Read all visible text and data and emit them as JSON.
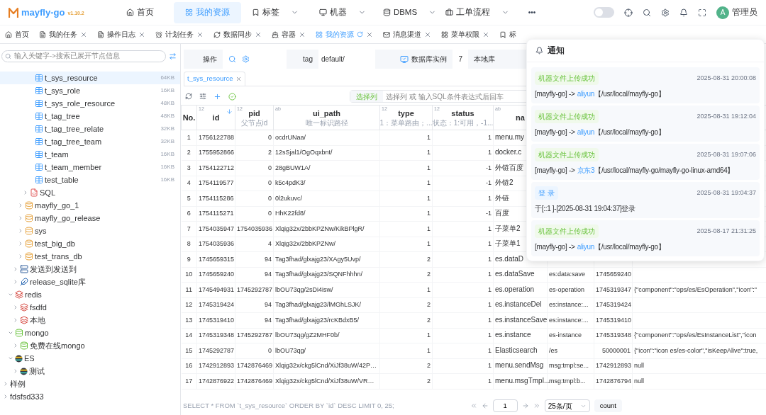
{
  "brand": {
    "name": "mayfly-go",
    "version": "v1.10.2"
  },
  "nav": [
    {
      "label": "首页",
      "selected": false,
      "dropdown": false
    },
    {
      "label": "我的资源",
      "selected": true,
      "dropdown": false
    },
    {
      "label": "标签",
      "selected": false,
      "dropdown": true
    },
    {
      "label": "机器",
      "selected": false,
      "dropdown": true
    },
    {
      "label": "DBMS",
      "selected": false,
      "dropdown": true
    },
    {
      "label": "工单流程",
      "selected": false,
      "dropdown": true
    }
  ],
  "more": "•••",
  "dark_mode": {
    "on": false
  },
  "user": {
    "initial": "A",
    "name": "管理员"
  },
  "tabs": [
    {
      "label": "首页",
      "selected": false,
      "closable": false
    },
    {
      "label": "我的任务",
      "selected": false,
      "closable": true
    },
    {
      "label": "操作日志",
      "selected": false,
      "closable": true
    },
    {
      "label": "计划任务",
      "selected": false,
      "closable": true
    },
    {
      "label": "数据同步",
      "selected": false,
      "closable": true
    },
    {
      "label": "容器",
      "selected": false,
      "closable": true
    },
    {
      "label": "我的资源",
      "selected": true,
      "closable": true
    },
    {
      "label": "消息渠道",
      "selected": false,
      "closable": true
    },
    {
      "label": "菜单权限",
      "selected": false,
      "closable": true
    },
    {
      "label": "标",
      "selected": false,
      "closable": false
    }
  ],
  "sidebar": {
    "search_placeholder": "输入关键字->搜索已展开节点信息",
    "tree": [
      {
        "children": [
          {
            "children": [
              {
                "children": [
                  {
                    "children": [
                      {
                        "children": [
                          {
                            "label": "t_sys_resource",
                            "kind": "table",
                            "size": "64KB",
                            "selected": true
                          },
                          {
                            "label": "t_sys_role",
                            "kind": "table",
                            "size": "16KB",
                            "selected": false
                          },
                          {
                            "label": "t_sys_role_resource",
                            "kind": "table",
                            "size": "48KB",
                            "selected": false
                          },
                          {
                            "label": "t_tag_tree",
                            "kind": "table",
                            "size": "48KB",
                            "selected": false
                          },
                          {
                            "label": "t_tag_tree_relate",
                            "kind": "table",
                            "size": "32KB",
                            "selected": false
                          },
                          {
                            "label": "t_tag_tree_team",
                            "kind": "table",
                            "size": "32KB",
                            "selected": false
                          },
                          {
                            "label": "t_team",
                            "kind": "table",
                            "size": "16KB",
                            "selected": false
                          },
                          {
                            "label": "t_team_member",
                            "kind": "table",
                            "size": "16KB",
                            "selected": false
                          },
                          {
                            "label": "test_table",
                            "kind": "table",
                            "size": "16KB",
                            "selected": false
                          }
                        ]
                      },
                      {
                        "label": "SQL",
                        "kind": "sql",
                        "expanded": false,
                        "selected": false
                      }
                    ]
                  },
                  {
                    "label": "mayfly_go_1",
                    "kind": "database",
                    "expanded": false,
                    "selected": false
                  },
                  {
                    "label": "mayfly_go_release",
                    "kind": "database",
                    "expanded": false,
                    "selected": false
                  },
                  {
                    "label": "sys",
                    "kind": "database",
                    "expanded": false,
                    "selected": false
                  },
                  {
                    "label": "test_big_db",
                    "kind": "database",
                    "expanded": false,
                    "selected": false
                  },
                  {
                    "label": "test_trans_db",
                    "kind": "database",
                    "expanded": false,
                    "selected": false
                  }
                ]
              },
              {
                "label": "发送到发送到",
                "kind": "server",
                "expanded": false,
                "selected": false
              },
              {
                "label": "release_sqlite库",
                "kind": "sqlite",
                "expanded": false,
                "selected": false
              }
            ]
          },
          {
            "label": "redis",
            "kind": "redis",
            "expanded": true,
            "selected": false,
            "children": [
              {
                "label": "fsdfd",
                "kind": "redis",
                "expanded": false,
                "selected": false
              },
              {
                "label": "本地",
                "kind": "redis",
                "expanded": false,
                "selected": false
              }
            ]
          },
          {
            "label": "mongo",
            "kind": "mongo",
            "expanded": true,
            "selected": false,
            "children": [
              {
                "label": "免费在线mongo",
                "kind": "mongo",
                "expanded": false,
                "selected": false
              }
            ]
          },
          {
            "label": "ES",
            "kind": "es",
            "expanded": true,
            "selected": false,
            "children": [
              {
                "label": "测试",
                "kind": "es",
                "expanded": false,
                "selected": false
              }
            ]
          }
        ]
      },
      {
        "label": "样例",
        "expanded": false,
        "selected": false
      },
      {
        "label": "fdsfsd333",
        "expanded": false,
        "selected": false
      }
    ]
  },
  "info_bar": {
    "action_label": "操作",
    "tag_label": "tag",
    "tag_value": "default/",
    "instance_label": "数据库实例",
    "instance_count": "7",
    "instance_name": "本地库"
  },
  "query_tabs": [
    {
      "label": "t_sys_resource",
      "selected": true
    }
  ],
  "toolbar": {
    "column_button": "选择列",
    "filter_placeholder": "选择列 或 输入SQL条件表达式后回车"
  },
  "table": {
    "columns": [
      {
        "label": "No."
      },
      {
        "label": "id",
        "type": "12",
        "sort_descending": true
      },
      {
        "label": "pid",
        "type": "12",
        "comment": "父节点id"
      },
      {
        "label": "ui_path",
        "type": "ab",
        "comment": "唯一标识路径"
      },
      {
        "label": "type",
        "type": "12",
        "comment": "1：菜单路由；..."
      },
      {
        "label": "status",
        "type": "12",
        "comment": "状态：1:可用，-1..."
      },
      {
        "label": "na",
        "type": "ab"
      }
    ],
    "rows": [
      [
        "1",
        "1756122788",
        "0",
        "ocdrUNaa/",
        "1",
        "1",
        "menu.my"
      ],
      [
        "2",
        "1755952866",
        "2",
        "12sSjal1/OgOqxbnt/",
        "1",
        "1",
        "docker.c"
      ],
      [
        "3",
        "1754122712",
        "0",
        "28gBUW1A/",
        "1",
        "-1",
        "外链百度"
      ],
      [
        "4",
        "1754119577",
        "0",
        "k5c4pdK3/",
        "1",
        "-1",
        "外链2"
      ],
      [
        "5",
        "1754115286",
        "0",
        "0l2ukuvc/",
        "1",
        "1",
        "外链"
      ],
      [
        "6",
        "1754115271",
        "0",
        "HhK22fd8/",
        "1",
        "-1",
        "百度"
      ],
      [
        "7",
        "1754035947",
        "1754035936",
        "Xlqig32x/2bbKPZNw/KikBPlgR/",
        "1",
        "1",
        "子菜单2"
      ],
      [
        "8",
        "1754035936",
        "4",
        "Xlqig32x/2bbKPZNw/",
        "1",
        "1",
        "子菜单1"
      ],
      [
        "9",
        "1745659315",
        "94",
        "Tag3fhad/glxajg23/XAgy5Uvp/",
        "2",
        "1",
        "es.dataD"
      ],
      [
        "10",
        "1745659240",
        "94",
        "Tag3fhad/glxajg23/SQNFhhhn/",
        "2",
        "1",
        "es.dataSave",
        "es:data:save",
        "1745659240"
      ],
      [
        "11",
        "1745494931",
        "1745292787",
        "lbOU73qg/2sDi4isw/",
        "1",
        "1",
        "es.operation",
        "es-operation",
        "1745319347",
        "{\"component\":\"ops/es/EsOperation\",\"icon\":\""
      ],
      [
        "12",
        "1745319424",
        "94",
        "Tag3fhad/glxajg23/lMGhLSJK/",
        "2",
        "1",
        "es.instanceDel",
        "es:instance:...",
        "1745319424"
      ],
      [
        "13",
        "1745319410",
        "94",
        "Tag3fhad/glxajg23/rcKBdxB5/",
        "2",
        "1",
        "es.instanceSave",
        "es:instance:...",
        "1745319410"
      ],
      [
        "14",
        "1745319348",
        "1745292787",
        "lbOU73qg/gZ2MHF0b/",
        "1",
        "1",
        "es.instance",
        "es-instance",
        "1745319348",
        "{\"component\":\"ops/es/EsInstanceList\",\"icon"
      ],
      [
        "15",
        "1745292787",
        "0",
        "lbOU73qg/",
        "1",
        "1",
        "Elasticsearch",
        "/es",
        "50000001",
        "{\"icon\":\"icon es/es-color\",\"isKeepAlive\":true,"
      ],
      [
        "16",
        "1742912893",
        "1742876469",
        "Xlqig32x/ckg5lCnd/XiJf38uW/42P…",
        "2",
        "1",
        "menu.sendMsg",
        "msg:tmpl:se...",
        "1742912893",
        "null"
      ],
      [
        "17",
        "1742876922",
        "1742876469",
        "Xlqig32x/ckg5lCnd/XiJf38uW/VR…",
        "2",
        "1",
        "menu.msgTmpl...",
        "msg:tmpl:b...",
        "1742876794",
        "null"
      ]
    ]
  },
  "status_bar": {
    "sql": "SELECT * FROM `t_sys_resource` ORDER BY `id` DESC LIMIT 0, 25;",
    "page": "1",
    "page_size": "25条/页",
    "count_button": "count"
  },
  "notifications": {
    "title": "通知",
    "items": [
      {
        "tag": "机器文件上传成功",
        "kind": "success",
        "time": "2025-08-31 20:00:08",
        "text": "[mayfly-go] ->",
        "link": "aliyun",
        "path": "【/usr/local/mayfly-go】"
      },
      {
        "tag": "机器文件上传成功",
        "kind": "success",
        "time": "2025-08-31 19:12:04",
        "text": "[mayfly-go] ->",
        "link": "aliyun",
        "path": "【/usr/local/mayfly-go】"
      },
      {
        "tag": "机器文件上传成功",
        "kind": "success",
        "time": "2025-08-31 19:07:06",
        "text": "[mayfly-go] ->",
        "link": "京东3",
        "path": "【/usr/local/mayfly-go/mayfly-go-linux-amd64】"
      },
      {
        "tag": "登 录",
        "kind": "info",
        "time": "2025-08-31 19:04:37",
        "text": "于[::1 ]-[2025-08-31 19:04:37]登录"
      },
      {
        "tag": "机器文件上传成功",
        "kind": "success",
        "time": "2025-08-17 21:31:25",
        "text": "[mayfly-go] ->",
        "link": "aliyun",
        "path": "【/usr/local/mayfly-go】"
      }
    ]
  }
}
